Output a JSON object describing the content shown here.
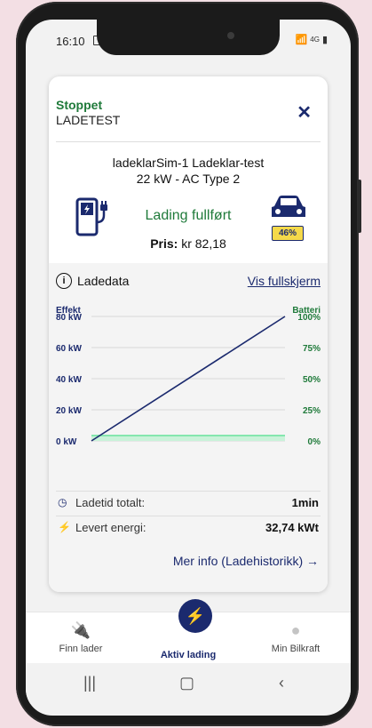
{
  "statusbar": {
    "time": "16:10",
    "network": "4G"
  },
  "session": {
    "status": "Stoppet",
    "name": "LADETEST"
  },
  "charger": {
    "name": "ladeklarSim-1 Ladeklar-test",
    "type": "22 kW - AC Type 2"
  },
  "charging": {
    "status_text": "Lading fullført",
    "battery_percent": "46%",
    "battery_level": 0.46
  },
  "price": {
    "label": "Pris:",
    "value": "kr 82,18"
  },
  "data_section": {
    "title": "Ladedata",
    "fullscreen_link": "Vis fullskjerm"
  },
  "chart_data": {
    "type": "line",
    "left_axis_label": "Effekt",
    "right_axis_label": "Batteri",
    "left_ticks": [
      "80 kW",
      "60 kW",
      "40 kW",
      "20 kW",
      "0 kW"
    ],
    "right_ticks": [
      "100%",
      "75%",
      "50%",
      "25%",
      "0%"
    ],
    "ylim_power": [
      0,
      80
    ],
    "ylim_battery": [
      0,
      100
    ],
    "series": [
      {
        "name": "Batteri",
        "color": "#1b2a6e",
        "x": [
          0,
          1
        ],
        "values": [
          0,
          100
        ]
      },
      {
        "name": "Effekt",
        "color": "#6fe3a0",
        "x": [
          0,
          1
        ],
        "values": [
          0,
          0
        ]
      }
    ],
    "grid": true
  },
  "stats": [
    {
      "icon": "clock-icon",
      "label": "Ladetid totalt:",
      "value": "1min"
    },
    {
      "icon": "plug-icon",
      "label": "Levert energi:",
      "value": "32,74 kWt"
    }
  ],
  "more_link": "Mer info (Ladehistorikk) →",
  "nav": {
    "items": [
      {
        "label": "Finn lader"
      },
      {
        "label": "Aktiv lading"
      },
      {
        "label": "Min Bilkraft"
      }
    ]
  },
  "colors": {
    "navy": "#1b2a6e",
    "green": "#1f7a3a",
    "battery_yellow": "#f5d94a"
  }
}
